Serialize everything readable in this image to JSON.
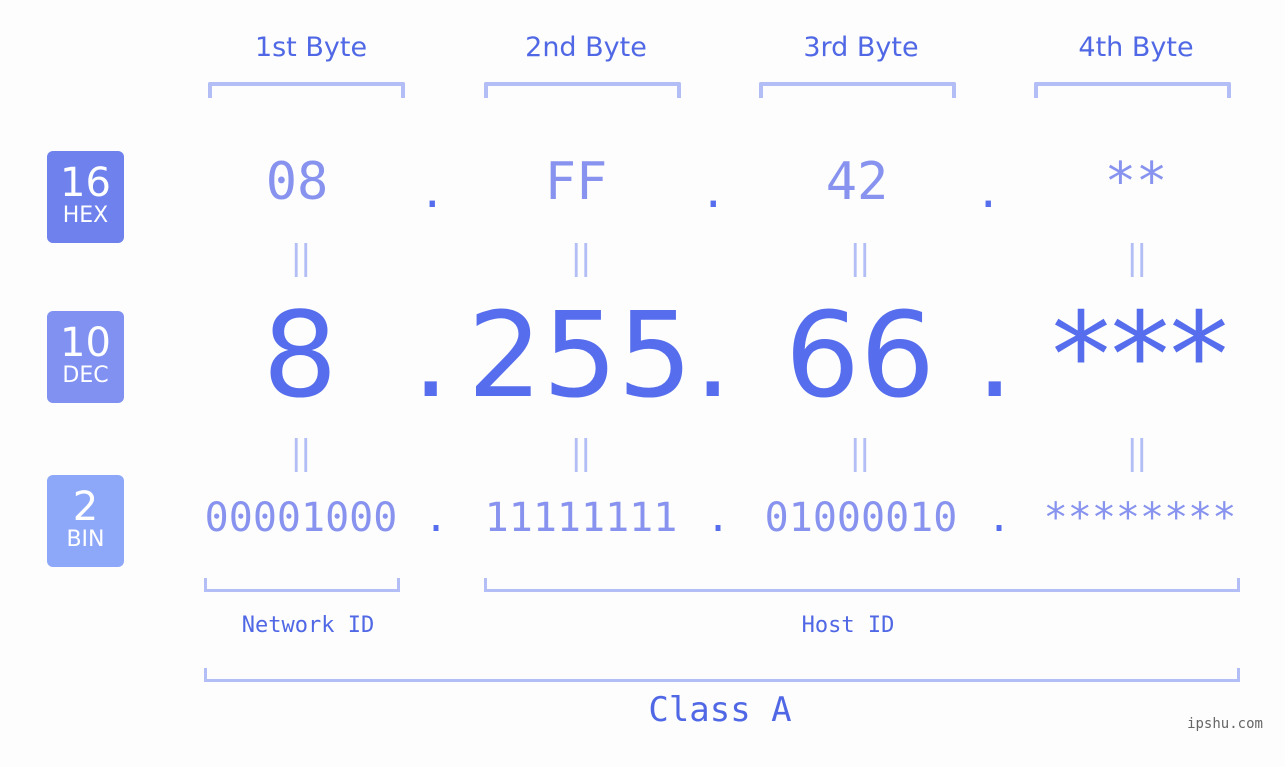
{
  "bytes": [
    {
      "title": "1st Byte",
      "hex": "08",
      "dec": "8",
      "bin": "00001000"
    },
    {
      "title": "2nd Byte",
      "hex": "FF",
      "dec": "255",
      "bin": "11111111"
    },
    {
      "title": "3rd Byte",
      "hex": "42",
      "dec": "66",
      "bin": "01000010"
    },
    {
      "title": "4th Byte",
      "hex": "**",
      "dec": "***",
      "bin": "********"
    }
  ],
  "badges": {
    "hex": {
      "num": "16",
      "label": "HEX",
      "color": "#6e81ec"
    },
    "dec": {
      "num": "10",
      "label": "DEC",
      "color": "#8091f1"
    },
    "bin": {
      "num": "2",
      "label": "BIN",
      "color": "#8ea8f9"
    }
  },
  "separator": ".",
  "equals": "||",
  "parts": {
    "network": "Network ID",
    "host": "Host ID"
  },
  "class_label": "Class A",
  "watermark": "ipshu.com",
  "colors": {
    "primary": "#566ded",
    "secondary": "#8793ee",
    "bracket": "#b3bef6"
  }
}
